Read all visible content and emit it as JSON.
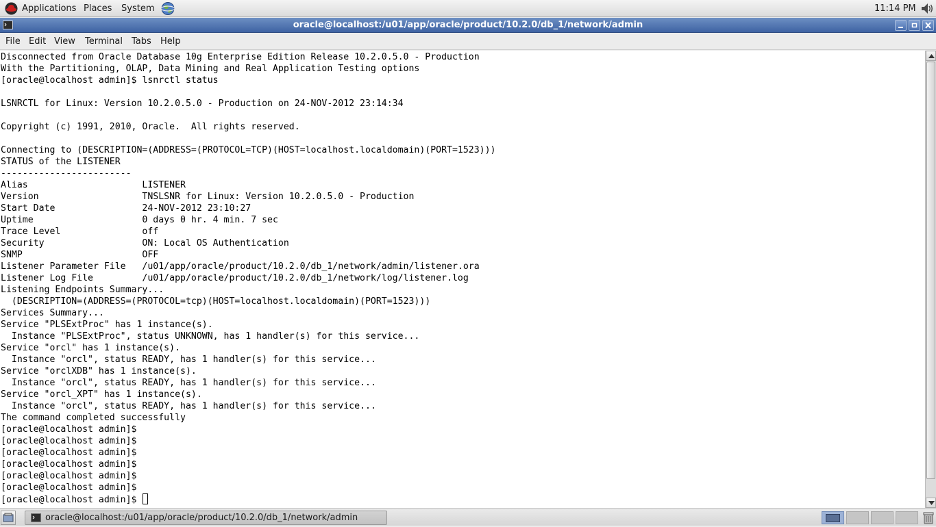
{
  "top_panel": {
    "menus": [
      "Applications",
      "Places",
      "System"
    ],
    "clock": "11:14 PM"
  },
  "window": {
    "title": "oracle@localhost:/u01/app/oracle/product/10.2.0/db_1/network/admin"
  },
  "menubar": {
    "items": [
      "File",
      "Edit",
      "View",
      "Terminal",
      "Tabs",
      "Help"
    ]
  },
  "terminal": {
    "lines": [
      "Disconnected from Oracle Database 10g Enterprise Edition Release 10.2.0.5.0 - Production",
      "With the Partitioning, OLAP, Data Mining and Real Application Testing options",
      "[oracle@localhost admin]$ lsnrctl status",
      "",
      "LSNRCTL for Linux: Version 10.2.0.5.0 - Production on 24-NOV-2012 23:14:34",
      "",
      "Copyright (c) 1991, 2010, Oracle.  All rights reserved.",
      "",
      "Connecting to (DESCRIPTION=(ADDRESS=(PROTOCOL=TCP)(HOST=localhost.localdomain)(PORT=1523)))",
      "STATUS of the LISTENER",
      "------------------------",
      "Alias                     LISTENER",
      "Version                   TNSLSNR for Linux: Version 10.2.0.5.0 - Production",
      "Start Date                24-NOV-2012 23:10:27",
      "Uptime                    0 days 0 hr. 4 min. 7 sec",
      "Trace Level               off",
      "Security                  ON: Local OS Authentication",
      "SNMP                      OFF",
      "Listener Parameter File   /u01/app/oracle/product/10.2.0/db_1/network/admin/listener.ora",
      "Listener Log File         /u01/app/oracle/product/10.2.0/db_1/network/log/listener.log",
      "Listening Endpoints Summary...",
      "  (DESCRIPTION=(ADDRESS=(PROTOCOL=tcp)(HOST=localhost.localdomain)(PORT=1523)))",
      "Services Summary...",
      "Service \"PLSExtProc\" has 1 instance(s).",
      "  Instance \"PLSExtProc\", status UNKNOWN, has 1 handler(s) for this service...",
      "Service \"orcl\" has 1 instance(s).",
      "  Instance \"orcl\", status READY, has 1 handler(s) for this service...",
      "Service \"orclXDB\" has 1 instance(s).",
      "  Instance \"orcl\", status READY, has 1 handler(s) for this service...",
      "Service \"orcl_XPT\" has 1 instance(s).",
      "  Instance \"orcl\", status READY, has 1 handler(s) for this service...",
      "The command completed successfully",
      "[oracle@localhost admin]$",
      "[oracle@localhost admin]$",
      "[oracle@localhost admin]$",
      "[oracle@localhost admin]$",
      "[oracle@localhost admin]$",
      "[oracle@localhost admin]$",
      "[oracle@localhost admin]$ "
    ]
  },
  "taskbar": {
    "items": [
      {
        "label": "oracle@localhost:/u01/app/oracle/product/10.2.0/db_1/network/admin",
        "icon": "terminal-icon"
      }
    ],
    "workspace_count": 4,
    "active_workspace": 1
  },
  "colors": {
    "titlebar": "#4a6ead",
    "active_workspace": "#9db2d6"
  },
  "icons": {
    "top_left": "redhat-icon",
    "web": "web-browser-icon",
    "volume": "volume-icon",
    "trash": "trash-icon"
  }
}
